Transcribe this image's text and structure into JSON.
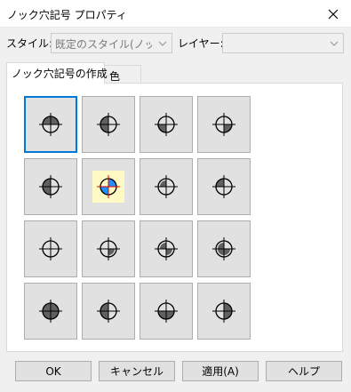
{
  "window": {
    "title": "ノック穴記号 プロパティ"
  },
  "fields": {
    "style_label": "スタイル:",
    "style_value": "既定のスタイル(ノック穴",
    "layer_label": "レイヤー:",
    "layer_value": ""
  },
  "tabs": [
    {
      "label": "ノック穴記号の作成",
      "active": true
    },
    {
      "label": "色",
      "active": false
    }
  ],
  "symbols": [
    {
      "id": "half-top",
      "quarters": [
        0,
        1
      ],
      "selected": true
    },
    {
      "id": "half-left-q",
      "quarters": [
        2,
        1
      ],
      "selected": false
    },
    {
      "id": "bottom-left",
      "quarters": [
        2
      ],
      "selected": false
    },
    {
      "id": "bottom-right",
      "quarters": [
        3
      ],
      "selected": false
    },
    {
      "id": "left-half",
      "quarters": [
        1,
        2
      ],
      "selected": false
    },
    {
      "id": "color-quarters",
      "quarters": [
        0,
        1,
        2,
        3
      ],
      "colored": true,
      "selected": false
    },
    {
      "id": "top-left-small",
      "quarters": [
        1
      ],
      "small": true,
      "selected": false
    },
    {
      "id": "top-left",
      "quarters": [
        1
      ],
      "selected": false
    },
    {
      "id": "empty",
      "quarters": [],
      "selected": false
    },
    {
      "id": "lower-right-small",
      "quarters": [
        3
      ],
      "small": true,
      "selected": false
    },
    {
      "id": "top-left-lower-right-small",
      "quarters": [
        1,
        3
      ],
      "small": true,
      "selected": false
    },
    {
      "id": "three-small",
      "quarters": [
        1,
        3,
        2
      ],
      "small": true,
      "selected": false
    },
    {
      "id": "full",
      "quarters": [
        0,
        1,
        2,
        3
      ],
      "selected": false
    },
    {
      "id": "half-left",
      "quarters": [
        1,
        2
      ],
      "selected": false
    },
    {
      "id": "lower-half",
      "quarters": [
        2,
        3
      ],
      "selected": false
    },
    {
      "id": "right-half",
      "quarters": [
        0,
        3
      ],
      "selected": false
    }
  ],
  "colors": {
    "fill": "#606060",
    "accent_blue": "#1e90ff",
    "accent_red": "#e00000",
    "selection": "#0078d7"
  },
  "buttons": {
    "ok": "OK",
    "cancel": "キャンセル",
    "apply": "適用(A)",
    "help": "ヘルプ"
  }
}
